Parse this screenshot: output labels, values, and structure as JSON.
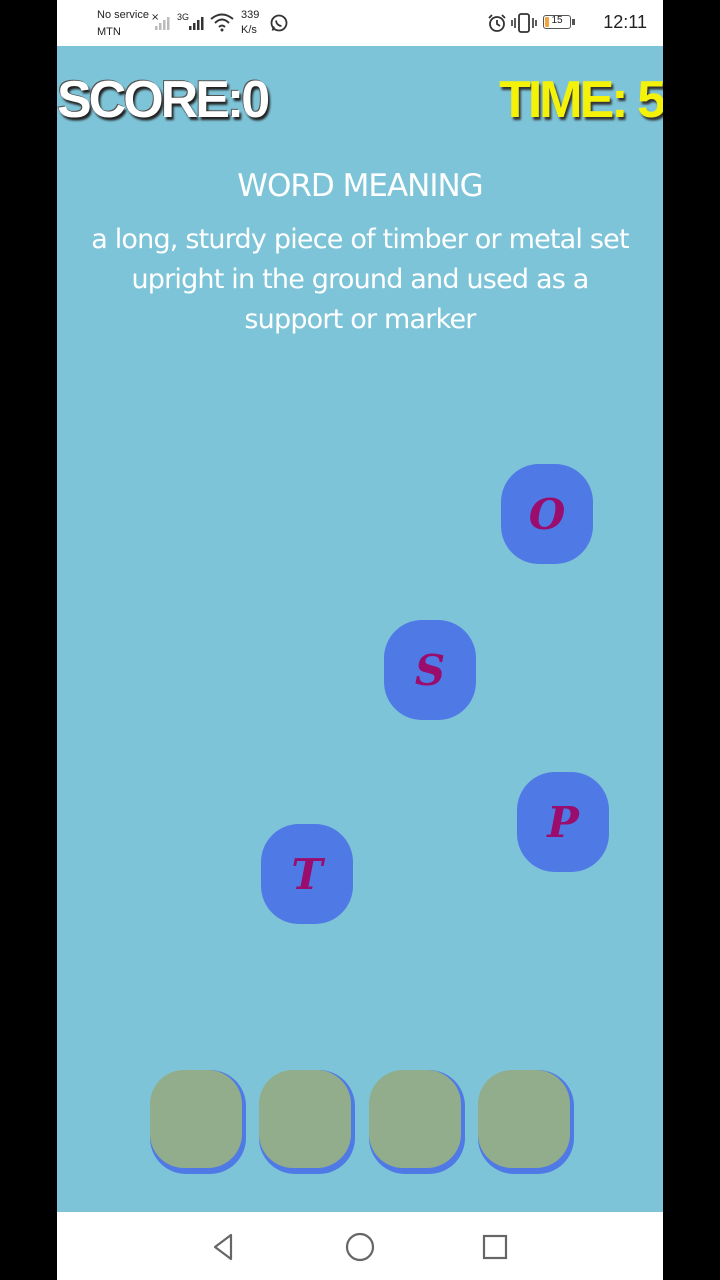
{
  "status_bar": {
    "carrier_line1": "No service",
    "carrier_line2": "MTN",
    "network_type": "3G",
    "speed_value": "339",
    "speed_unit": "K/s",
    "battery_level": "15",
    "time": "12:11"
  },
  "game": {
    "score_text": "SCORE:0",
    "timer_text": "TIME: 5",
    "meaning_heading": "WORD MEANING",
    "meaning_text": "a long, sturdy piece of timber or metal set upright in the ground and used as a support or marker",
    "letters": [
      "O",
      "S",
      "P",
      "T"
    ],
    "answer_slots": [
      "",
      "",
      "",
      ""
    ]
  },
  "colors": {
    "background": "#7ec4d8",
    "tile": "#4f7ae6",
    "tile_letter": "#9a0d6c",
    "slot": "#91ad8b",
    "timer": "#f5f20a",
    "score": "#ffffff"
  },
  "nav": {
    "back": "back-icon",
    "home": "home-icon",
    "recents": "recents-icon"
  }
}
